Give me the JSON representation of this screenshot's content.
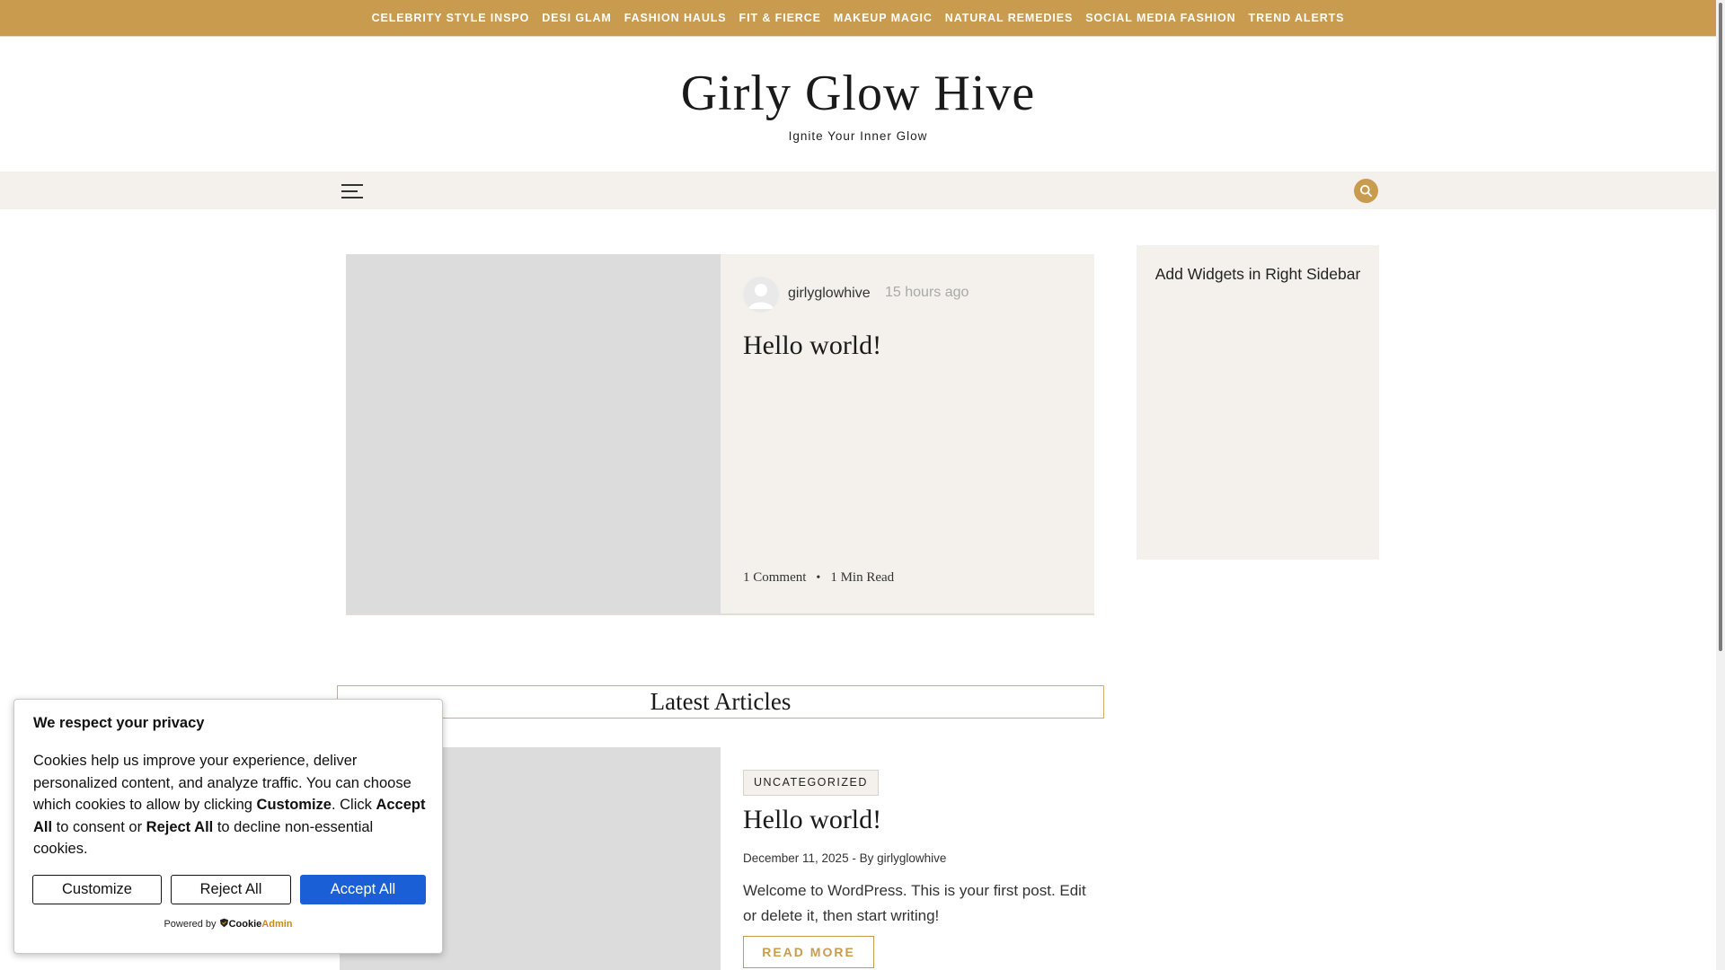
{
  "colors": {
    "accent": "#c89b4f",
    "panel": "#f4f1ec",
    "placeholder": "#dcdcdc",
    "primary_button": "#1a5fd6"
  },
  "top_nav": {
    "items": [
      "CELEBRITY STYLE INSPO",
      "DESI GLAM",
      "FASHION HAULS",
      "FIT & FIERCE",
      "MAKEUP MAGIC",
      "NATURAL REMEDIES",
      "SOCIAL MEDIA FASHION",
      "TREND ALERTS"
    ]
  },
  "header": {
    "title": "Girly Glow Hive",
    "tagline": "Ignite Your Inner Glow"
  },
  "nav_bar": {
    "menu_icon": "hamburger-menu-icon",
    "search_icon": "search-icon"
  },
  "featured": {
    "author": "girlyglowhive",
    "time_ago": "15 hours ago",
    "title": "Hello world!",
    "comments": "1 Comment",
    "read_time": "1 Min Read"
  },
  "sidebar": {
    "placeholder_text": "Add Widgets in Right Sidebar"
  },
  "latest": {
    "heading": "Latest Articles",
    "article": {
      "category": "UNCATEGORIZED",
      "title": "Hello world!",
      "meta": "December 11, 2025 - By girlyglowhive",
      "excerpt": "Welcome to WordPress. This is your first post. Edit or delete it, then start writing!",
      "read_more": "READ MORE"
    }
  },
  "cookie_banner": {
    "title": "We respect your privacy",
    "body_1": "Cookies help us improve your experience, deliver personalized content, and analyze traffic. You can choose which cookies to allow by clicking ",
    "body_customize": "Customize",
    "body_2": ". Click ",
    "body_accept": "Accept All",
    "body_3": " to consent or ",
    "body_reject": "Reject All",
    "body_4": " to decline non-essential cookies.",
    "customize_label": "Customize",
    "reject_label": "Reject All",
    "accept_label": "Accept All",
    "powered_by": "Powered by",
    "brand_cookie": "Cookie",
    "brand_admin": "Admin"
  }
}
